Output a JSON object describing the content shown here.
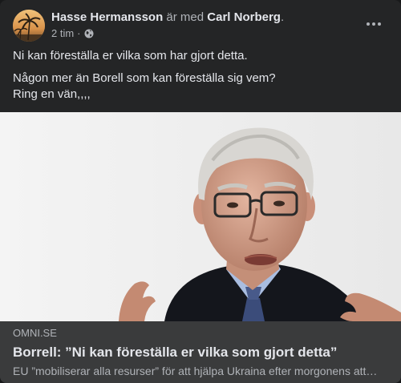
{
  "post": {
    "author_name": "Hasse Hermansson",
    "with_text": "är med",
    "tagged_name": "Carl Norberg",
    "tagged_suffix": ".",
    "timestamp": "2 tim",
    "separator": "·",
    "audience_icon": "globe-icon",
    "more_icon": "more-options-icon",
    "text": {
      "line1": "Ni kan föreställa er vilka som har gjort detta.",
      "line2": "Någon mer än Borell som kan föreställa sig vem?",
      "line3": "Ring en vän,,,,"
    }
  },
  "link_preview": {
    "domain": "OMNI.SE",
    "title": "Borrell: ”Ni kan föreställa er vilka som gjort detta”",
    "description": "EU ”mobiliserar alla resurser” för att hjälpa Ukraina efter morgonens attacker"
  },
  "colors": {
    "card_bg": "#242526",
    "link_info_bg": "#3a3b3c",
    "primary_text": "#e4e6eb",
    "secondary_text": "#b0b3b8"
  }
}
